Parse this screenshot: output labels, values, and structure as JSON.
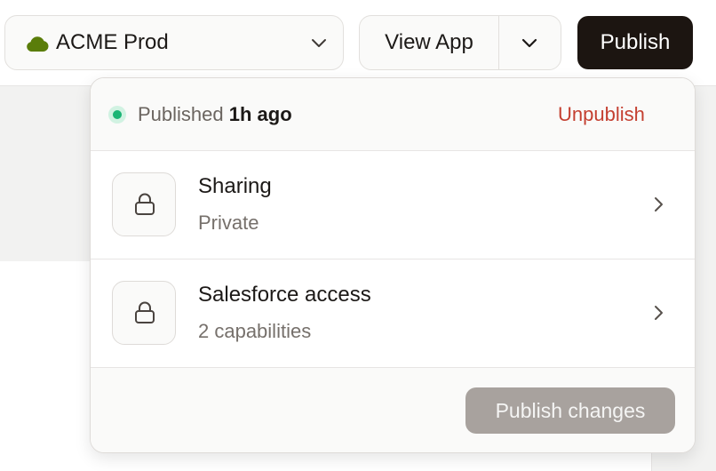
{
  "toolbar": {
    "environment": {
      "label": "ACME Prod",
      "icon": "cloud-icon",
      "icon_color": "#5a7d0a"
    },
    "view_app": {
      "label": "View App"
    },
    "publish": {
      "label": "Publish"
    }
  },
  "popover": {
    "status": {
      "prefix": "Published",
      "time": "1h ago",
      "dot_color": "#1bb575"
    },
    "unpublish_label": "Unpublish",
    "items": [
      {
        "title": "Sharing",
        "subtitle": "Private",
        "icon": "lock-icon"
      },
      {
        "title": "Salesforce access",
        "subtitle": "2 capabilities",
        "icon": "lock-icon"
      }
    ],
    "publish_changes_label": "Publish changes"
  },
  "colors": {
    "primary_button": "#1c1511",
    "danger": "#c43f30",
    "disabled_button": "#a8a29e"
  }
}
